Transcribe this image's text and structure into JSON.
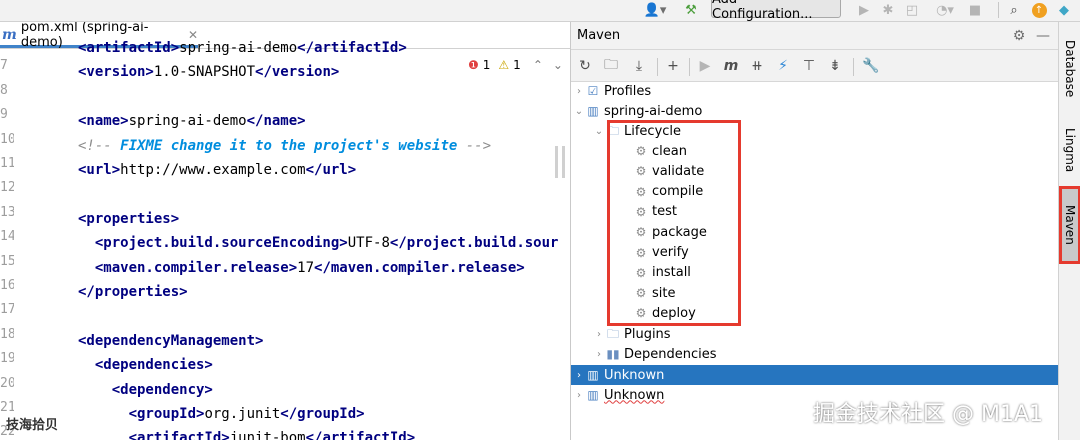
{
  "toolbar": {
    "add_configuration": "Add Configuration..."
  },
  "editor": {
    "tab_label": "pom.xml (spring-ai-demo)",
    "inspections": {
      "errors": "1",
      "warnings": "1"
    },
    "line_numbers": [
      "7",
      "8",
      "9",
      "10",
      "11",
      "12",
      "13",
      "14",
      "15",
      "16",
      "17",
      "18",
      "19",
      "20",
      "21",
      "22"
    ],
    "lines": [
      {
        "indent": "",
        "tag": "<artifactId>",
        "text": "spring-ai-demo",
        "close": "</artifactId>"
      },
      {
        "indent": "",
        "tag": "<version>",
        "text": "1.0-SNAPSHOT",
        "close": "</version>"
      },
      {
        "indent": "",
        "tag": "",
        "text": "",
        "close": ""
      },
      {
        "indent": "",
        "tag": "<name>",
        "text": "spring-ai-demo",
        "close": "</name>"
      },
      {
        "indent": "",
        "comment_start": "<!-- ",
        "todo": "FIXME change it to the project's website",
        "comment_end": " -->"
      },
      {
        "indent": "",
        "tag": "<url>",
        "text": "http://www.example.com",
        "close": "</url>"
      },
      {
        "indent": "",
        "tag": "",
        "text": "",
        "close": ""
      },
      {
        "indent": "",
        "tag": "<properties>",
        "text": "",
        "close": ""
      },
      {
        "indent": "  ",
        "tag": "<project.build.sourceEncoding>",
        "text": "UTF-8",
        "close": "</project.build.sour"
      },
      {
        "indent": "  ",
        "tag": "<maven.compiler.release>",
        "text": "17",
        "close": "</maven.compiler.release>"
      },
      {
        "indent": "",
        "tag": "</properties>",
        "text": "",
        "close": ""
      },
      {
        "indent": "",
        "tag": "",
        "text": "",
        "close": ""
      },
      {
        "indent": "",
        "tag": "<dependencyManagement>",
        "text": "",
        "close": ""
      },
      {
        "indent": "  ",
        "tag": "<dependencies>",
        "text": "",
        "close": ""
      },
      {
        "indent": "    ",
        "tag": "<dependency>",
        "text": "",
        "close": ""
      },
      {
        "indent": "      ",
        "tag": "<groupId>",
        "text": "org.junit",
        "close": "</groupId>"
      },
      {
        "indent": "      ",
        "tag": "<artifactId>",
        "text": "junit-bom",
        "close": "</artifactId>"
      }
    ],
    "bottom_text": "技海拾贝"
  },
  "maven": {
    "title": "Maven",
    "tree": {
      "profiles": "Profiles",
      "project": "spring-ai-demo",
      "lifecycle": "Lifecycle",
      "phases": [
        "clean",
        "validate",
        "compile",
        "test",
        "package",
        "verify",
        "install",
        "site",
        "deploy"
      ],
      "plugins": "Plugins",
      "dependencies": "Dependencies",
      "unknown_selected": "Unknown",
      "unknown_2": "Unknown"
    }
  },
  "stripe": {
    "database": "Database",
    "lingma": "Lingma",
    "maven": "Maven"
  },
  "watermark": "掘金技术社区 @ M1A1",
  "colors": {
    "selection": "#2675bf",
    "highlight_box": "#e53a2e",
    "xml_tag": "#000080",
    "todo_comment": "#008dde"
  }
}
